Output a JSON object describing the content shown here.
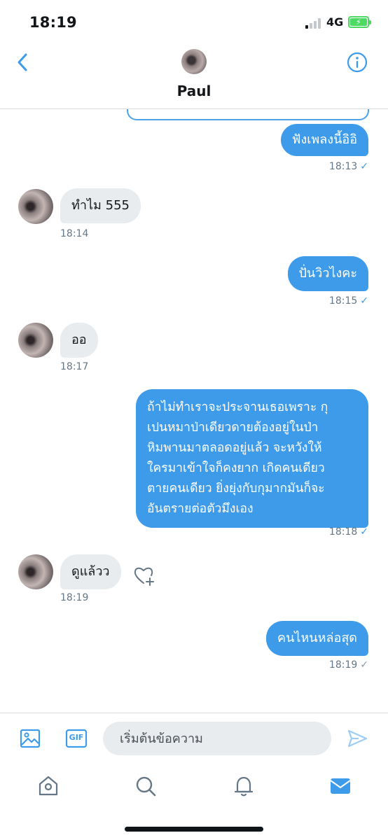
{
  "status_bar": {
    "time": "18:19",
    "network": "4G",
    "battery_color": "#4cd964"
  },
  "header": {
    "contact_name": "Paul",
    "back_icon": "chevron-left-icon",
    "info_icon": "info-icon"
  },
  "colors": {
    "accent": "#3d9bea",
    "incoming_bubble": "#e8ecef",
    "outgoing_text": "#ffffff"
  },
  "messages": [
    {
      "direction": "out",
      "text": "ฟังเพลงนี้อิอิ",
      "time": "18:13",
      "read": true
    },
    {
      "direction": "in",
      "text": "ทำไม 555",
      "time": "18:14"
    },
    {
      "direction": "out",
      "text": "ปั่นวิวไงคะ",
      "time": "18:15",
      "read": true
    },
    {
      "direction": "in",
      "text": "ออ",
      "time": "18:17"
    },
    {
      "direction": "out",
      "lines": [
        "ถ้าไม่ทำเราจะประจานเธอเพราะ กุ",
        "เปนหมาป่าเดียวดายต้องอยู่ในป่า",
        "หิมพานมาตลอดอยู่แล้ว จะหวังให้",
        "ใครมาเข้าใจก็คงยาก เกิดคนเดียว",
        "ตายคนเดียว ยิ่งยุ่งกับกุมากมันก็จะ",
        "อันตรายต่อตัวมึงเอง"
      ],
      "time": "18:18",
      "read": true
    },
    {
      "direction": "in",
      "text": "ดูแล้วว",
      "time": "18:19",
      "reaction_icon": "heart-add-icon"
    },
    {
      "direction": "out",
      "text": "คนไหนหล่อสุด",
      "time": "18:19",
      "read": false
    }
  ],
  "receipt_glyph": "✓",
  "composer": {
    "placeholder": "เริ่มต้นข้อความ",
    "image_icon": "image-icon",
    "gif_label": "GIF",
    "send_icon": "send-icon"
  },
  "tabbar": {
    "items": [
      "home-icon",
      "search-icon",
      "notifications-bell-icon",
      "messages-mail-icon"
    ],
    "active": "messages-mail-icon"
  }
}
